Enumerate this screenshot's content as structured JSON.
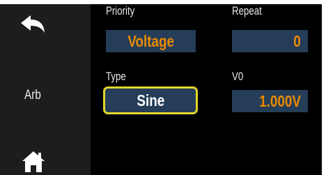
{
  "sidebar": {
    "back_icon": "back-arrow-icon",
    "mode_label": "Arb",
    "home_icon": "home-icon"
  },
  "fields": {
    "priority": {
      "label": "Priority",
      "value": "Voltage"
    },
    "repeat": {
      "label": "Repeat",
      "value": "0"
    },
    "type": {
      "label": "Type",
      "value": "Sine"
    },
    "v0": {
      "label": "V0",
      "value": "1.000V"
    }
  },
  "colors": {
    "background": "#000000",
    "sidebar": "#1d1d1d",
    "field_bg": "#253d58",
    "value_orange": "#e98a00",
    "selected_border": "#e2d52a"
  }
}
